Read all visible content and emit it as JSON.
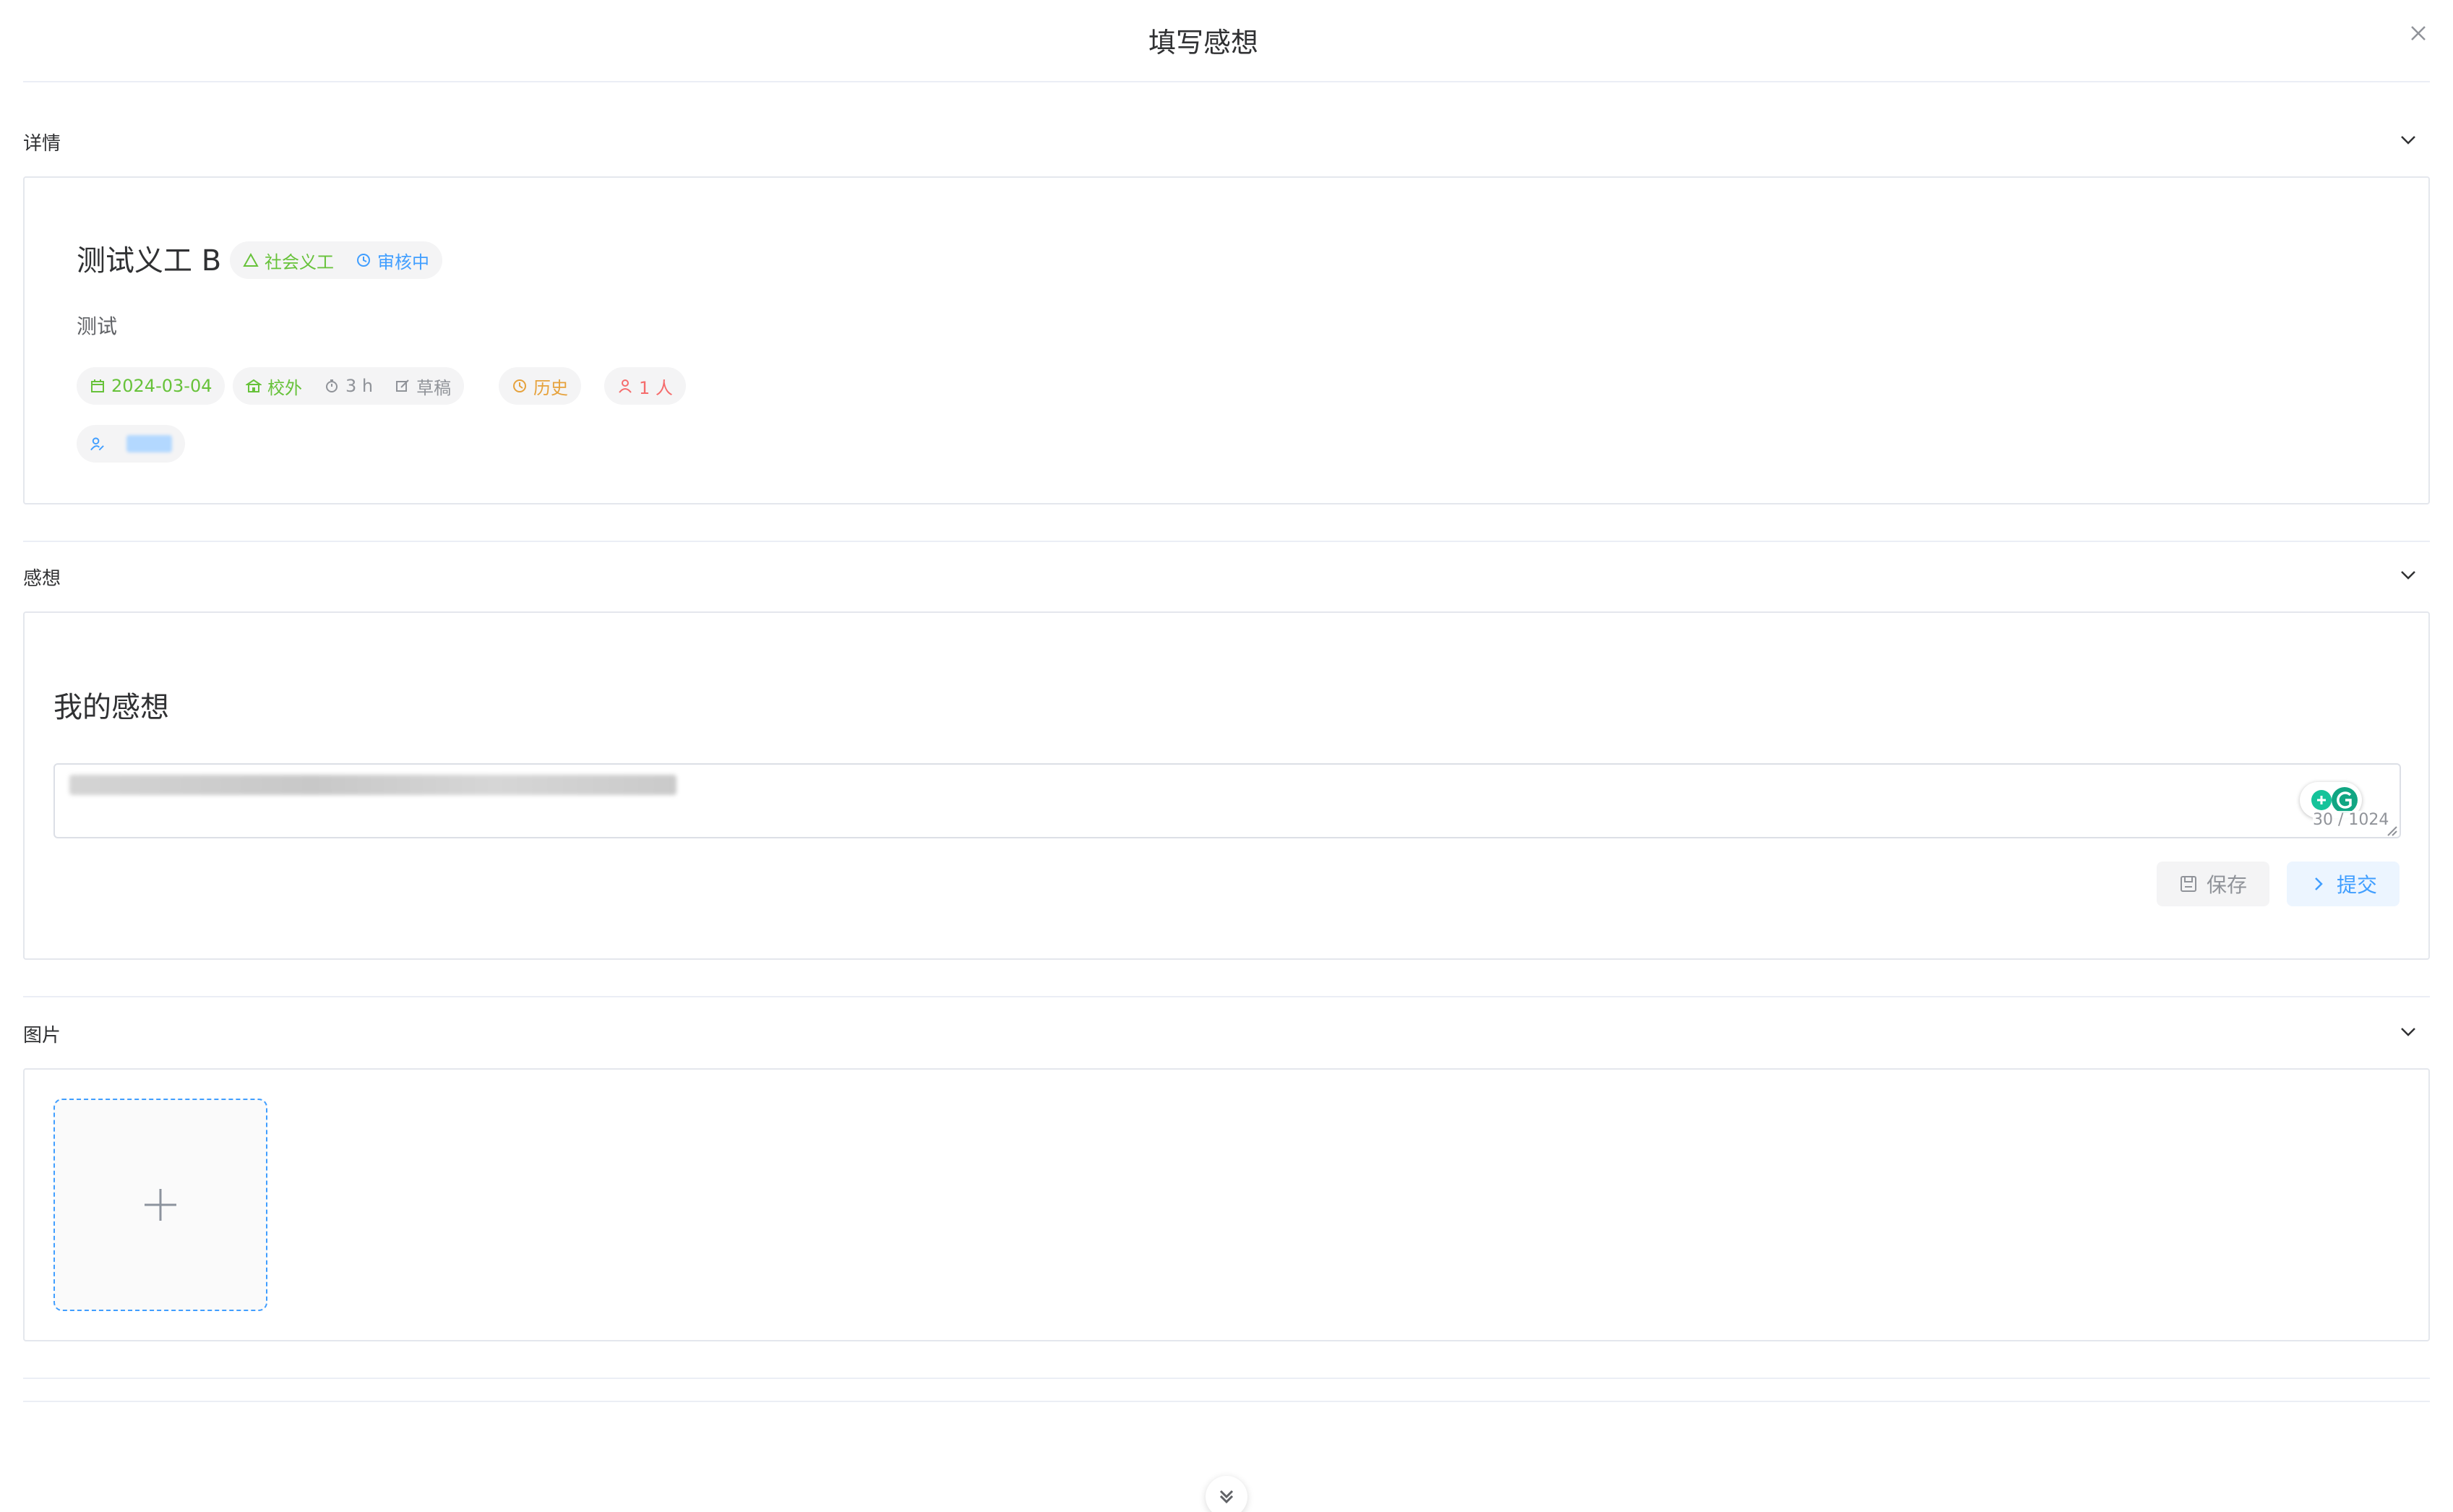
{
  "dialog": {
    "title": "填写感想",
    "close_icon": "close-icon"
  },
  "details": {
    "section_title": "详情",
    "title": "测试义工 B",
    "category_tag": "社会义工",
    "status_tag": "审核中",
    "description": "测试",
    "date": "2024-03-04",
    "location": "校外",
    "duration": "3 h",
    "state": "草稿",
    "history": "历史",
    "participants": "1 人"
  },
  "reflection": {
    "section_title": "感想",
    "subtitle": "我的感想",
    "counter": "30 / 1024",
    "save_label": "保存",
    "submit_label": "提交"
  },
  "images": {
    "section_title": "图片"
  },
  "colors": {
    "primary": "#409eff",
    "success": "#67c23a",
    "warning": "#e6a23c",
    "danger": "#f56c6c",
    "info": "#909399"
  }
}
